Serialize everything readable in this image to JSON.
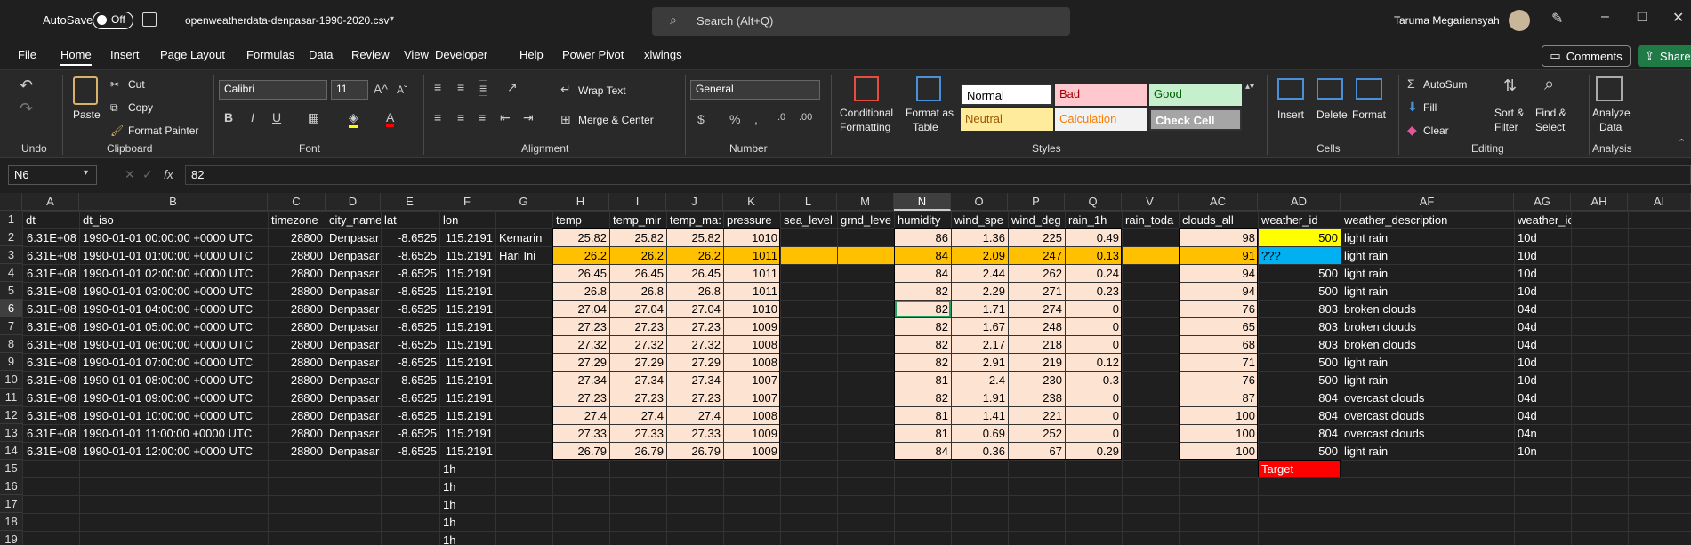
{
  "titlebar": {
    "autosave_label": "AutoSave",
    "autosave_state": "Off",
    "filename": "openweatherdata-denpasar-1990-2020.csv",
    "search_placeholder": "Search (Alt+Q)",
    "user_name": "Taruma Megariansyah"
  },
  "menu": [
    "File",
    "Home",
    "Insert",
    "Page Layout",
    "Formulas",
    "Data",
    "Review",
    "View",
    "Developer",
    "Help",
    "Power Pivot",
    "xlwings"
  ],
  "menu_active": "Home",
  "menu_right": {
    "comments": "Comments",
    "share": "Share"
  },
  "ribbon": {
    "undo_group": "Undo",
    "clipboard": {
      "group": "Clipboard",
      "paste": "Paste",
      "cut": "Cut",
      "copy": "Copy",
      "format_painter": "Format Painter"
    },
    "font": {
      "group": "Font",
      "name": "Calibri",
      "size": "11"
    },
    "alignment": {
      "group": "Alignment",
      "wrap": "Wrap Text",
      "merge": "Merge & Center"
    },
    "number": {
      "group": "Number",
      "format": "General"
    },
    "styles": {
      "group": "Styles",
      "conditional": "Conditional",
      "conditional2": "Formatting",
      "format_as": "Format as",
      "format_as2": "Table",
      "cells": [
        {
          "label": "Normal",
          "bg": "#ffffff",
          "fg": "#000000"
        },
        {
          "label": "Bad",
          "bg": "#ffc7ce",
          "fg": "#9c0006"
        },
        {
          "label": "Good",
          "bg": "#c6efce",
          "fg": "#006100"
        },
        {
          "label": "Neutral",
          "bg": "#ffeb9c",
          "fg": "#9c5700"
        },
        {
          "label": "Calculation",
          "bg": "#f2f2f2",
          "fg": "#fa7d00"
        },
        {
          "label": "Check Cell",
          "bg": "#a5a5a5",
          "fg": "#ffffff"
        }
      ]
    },
    "cells_group": {
      "group": "Cells",
      "insert": "Insert",
      "delete": "Delete",
      "format": "Format"
    },
    "editing": {
      "group": "Editing",
      "autosum": "AutoSum",
      "fill": "Fill",
      "clear": "Clear",
      "sort": "Sort &",
      "sort2": "Filter",
      "find": "Find &",
      "find2": "Select"
    },
    "analysis": {
      "group": "Analysis",
      "analyze": "Analyze",
      "analyze2": "Data"
    }
  },
  "formula_bar": {
    "name_box": "N6",
    "formula": "82"
  },
  "columns": [
    "A",
    "B",
    "C",
    "D",
    "E",
    "F",
    "G",
    "H",
    "I",
    "J",
    "K",
    "L",
    "M",
    "N",
    "O",
    "P",
    "Q",
    "V",
    "AC",
    "AD",
    "AF",
    "AG",
    "AH",
    "AI"
  ],
  "row_numbers": [
    "1",
    "2",
    "3",
    "4",
    "5",
    "6",
    "7",
    "8",
    "9",
    "10",
    "11",
    "12",
    "13",
    "14",
    "15",
    "16",
    "17",
    "18",
    "19"
  ],
  "headers": {
    "dt": "dt",
    "dt_iso": "dt_iso",
    "timezone": "timezone",
    "city": "city_name",
    "lat": "lat",
    "lon": "lon",
    "temp": "temp",
    "temp_min": "temp_mir",
    "temp_max": "temp_ma:",
    "pressure": "pressure",
    "sea": "sea_level",
    "grnd": "grnd_leve",
    "humidity": "humidity",
    "wind_speed": "wind_spe",
    "wind_deg": "wind_deg",
    "rain": "rain_1h",
    "rain_today": "rain_toda",
    "clouds": "clouds_all",
    "weather_id": "weather_id",
    "desc": "weather_description",
    "icon": "weather_icon"
  },
  "rows": [
    {
      "dt": "6.31E+08",
      "iso": "1990-01-01 00:00:00 +0000 UTC",
      "tz": "28800",
      "city": "Denpasar",
      "lat": "-8.6525",
      "lon": "115.2191",
      "g": "Kemarin",
      "temp": "25.82",
      "tmin": "25.82",
      "tmax": "25.82",
      "p": "1010",
      "hum": "86",
      "ws": "1.36",
      "wd": "225",
      "rain": "0.49",
      "cl": "98",
      "wid": "500",
      "desc": "light rain",
      "icon": "10d"
    },
    {
      "dt": "6.31E+08",
      "iso": "1990-01-01 01:00:00 +0000 UTC",
      "tz": "28800",
      "city": "Denpasar",
      "lat": "-8.6525",
      "lon": "115.2191",
      "g": "Hari Ini",
      "temp": "26.2",
      "tmin": "26.2",
      "tmax": "26.2",
      "p": "1011",
      "hum": "84",
      "ws": "2.09",
      "wd": "247",
      "rain": "0.13",
      "cl": "91",
      "wid": "???",
      "desc": "light rain",
      "icon": "10d"
    },
    {
      "dt": "6.31E+08",
      "iso": "1990-01-01 02:00:00 +0000 UTC",
      "tz": "28800",
      "city": "Denpasar",
      "lat": "-8.6525",
      "lon": "115.2191",
      "g": "",
      "temp": "26.45",
      "tmin": "26.45",
      "tmax": "26.45",
      "p": "1011",
      "hum": "84",
      "ws": "2.44",
      "wd": "262",
      "rain": "0.24",
      "cl": "94",
      "wid": "500",
      "desc": "light rain",
      "icon": "10d"
    },
    {
      "dt": "6.31E+08",
      "iso": "1990-01-01 03:00:00 +0000 UTC",
      "tz": "28800",
      "city": "Denpasar",
      "lat": "-8.6525",
      "lon": "115.2191",
      "g": "",
      "temp": "26.8",
      "tmin": "26.8",
      "tmax": "26.8",
      "p": "1011",
      "hum": "82",
      "ws": "2.29",
      "wd": "271",
      "rain": "0.23",
      "cl": "94",
      "wid": "500",
      "desc": "light rain",
      "icon": "10d"
    },
    {
      "dt": "6.31E+08",
      "iso": "1990-01-01 04:00:00 +0000 UTC",
      "tz": "28800",
      "city": "Denpasar",
      "lat": "-8.6525",
      "lon": "115.2191",
      "g": "",
      "temp": "27.04",
      "tmin": "27.04",
      "tmax": "27.04",
      "p": "1010",
      "hum": "82",
      "ws": "1.71",
      "wd": "274",
      "rain": "0",
      "cl": "76",
      "wid": "803",
      "desc": "broken clouds",
      "icon": "04d"
    },
    {
      "dt": "6.31E+08",
      "iso": "1990-01-01 05:00:00 +0000 UTC",
      "tz": "28800",
      "city": "Denpasar",
      "lat": "-8.6525",
      "lon": "115.2191",
      "g": "",
      "temp": "27.23",
      "tmin": "27.23",
      "tmax": "27.23",
      "p": "1009",
      "hum": "82",
      "ws": "1.67",
      "wd": "248",
      "rain": "0",
      "cl": "65",
      "wid": "803",
      "desc": "broken clouds",
      "icon": "04d"
    },
    {
      "dt": "6.31E+08",
      "iso": "1990-01-01 06:00:00 +0000 UTC",
      "tz": "28800",
      "city": "Denpasar",
      "lat": "-8.6525",
      "lon": "115.2191",
      "g": "",
      "temp": "27.32",
      "tmin": "27.32",
      "tmax": "27.32",
      "p": "1008",
      "hum": "82",
      "ws": "2.17",
      "wd": "218",
      "rain": "0",
      "cl": "68",
      "wid": "803",
      "desc": "broken clouds",
      "icon": "04d"
    },
    {
      "dt": "6.31E+08",
      "iso": "1990-01-01 07:00:00 +0000 UTC",
      "tz": "28800",
      "city": "Denpasar",
      "lat": "-8.6525",
      "lon": "115.2191",
      "g": "",
      "temp": "27.29",
      "tmin": "27.29",
      "tmax": "27.29",
      "p": "1008",
      "hum": "82",
      "ws": "2.91",
      "wd": "219",
      "rain": "0.12",
      "cl": "71",
      "wid": "500",
      "desc": "light rain",
      "icon": "10d"
    },
    {
      "dt": "6.31E+08",
      "iso": "1990-01-01 08:00:00 +0000 UTC",
      "tz": "28800",
      "city": "Denpasar",
      "lat": "-8.6525",
      "lon": "115.2191",
      "g": "",
      "temp": "27.34",
      "tmin": "27.34",
      "tmax": "27.34",
      "p": "1007",
      "hum": "81",
      "ws": "2.4",
      "wd": "230",
      "rain": "0.3",
      "cl": "76",
      "wid": "500",
      "desc": "light rain",
      "icon": "10d"
    },
    {
      "dt": "6.31E+08",
      "iso": "1990-01-01 09:00:00 +0000 UTC",
      "tz": "28800",
      "city": "Denpasar",
      "lat": "-8.6525",
      "lon": "115.2191",
      "g": "",
      "temp": "27.23",
      "tmin": "27.23",
      "tmax": "27.23",
      "p": "1007",
      "hum": "82",
      "ws": "1.91",
      "wd": "238",
      "rain": "0",
      "cl": "87",
      "wid": "804",
      "desc": "overcast clouds",
      "icon": "04d"
    },
    {
      "dt": "6.31E+08",
      "iso": "1990-01-01 10:00:00 +0000 UTC",
      "tz": "28800",
      "city": "Denpasar",
      "lat": "-8.6525",
      "lon": "115.2191",
      "g": "",
      "temp": "27.4",
      "tmin": "27.4",
      "tmax": "27.4",
      "p": "1008",
      "hum": "81",
      "ws": "1.41",
      "wd": "221",
      "rain": "0",
      "cl": "100",
      "wid": "804",
      "desc": "overcast clouds",
      "icon": "04d"
    },
    {
      "dt": "6.31E+08",
      "iso": "1990-01-01 11:00:00 +0000 UTC",
      "tz": "28800",
      "city": "Denpasar",
      "lat": "-8.6525",
      "lon": "115.2191",
      "g": "",
      "temp": "27.33",
      "tmin": "27.33",
      "tmax": "27.33",
      "p": "1009",
      "hum": "81",
      "ws": "0.69",
      "wd": "252",
      "rain": "0",
      "cl": "100",
      "wid": "804",
      "desc": "overcast clouds",
      "icon": "04n"
    },
    {
      "dt": "6.31E+08",
      "iso": "1990-01-01 12:00:00 +0000 UTC",
      "tz": "28800",
      "city": "Denpasar",
      "lat": "-8.6525",
      "lon": "115.2191",
      "g": "",
      "temp": "26.79",
      "tmin": "26.79",
      "tmax": "26.79",
      "p": "1009",
      "hum": "84",
      "ws": "0.36",
      "wd": "67",
      "rain": "0.29",
      "cl": "100",
      "wid": "500",
      "desc": "light rain",
      "icon": "10n"
    }
  ],
  "lon_extra": [
    "1h",
    "1h",
    "1h",
    "1h",
    "1h"
  ],
  "target_label": "Target",
  "colors": {
    "peach": "#fde3d2",
    "orange": "#ffc000",
    "yellow": "#ffff00",
    "blue": "#00b0f0",
    "red": "#ff0000"
  }
}
